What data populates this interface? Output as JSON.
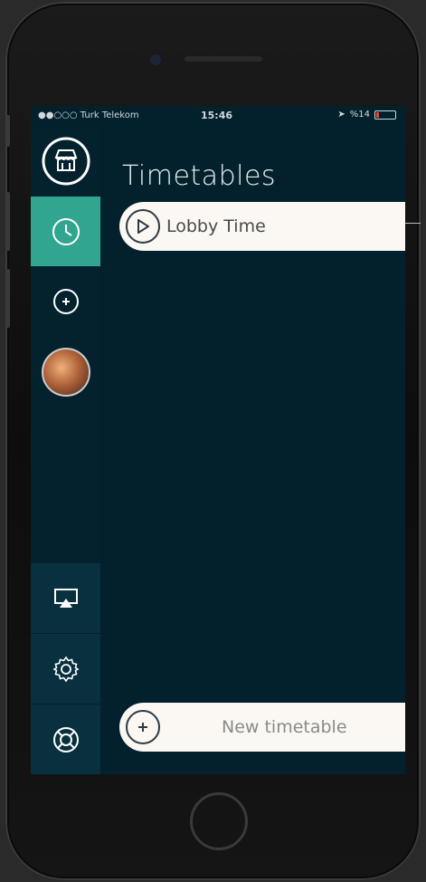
{
  "status_bar": {
    "carrier": "●●○○○ Turk Telekom",
    "time": "15:46",
    "battery": "%14",
    "battery_level": 0.14
  },
  "sidebar": {
    "items": [
      {
        "name": "store-icon"
      },
      {
        "name": "clock-icon",
        "active": true
      },
      {
        "name": "add-circle-icon"
      },
      {
        "name": "avatar"
      }
    ],
    "bottom_items": [
      {
        "name": "airplay-icon"
      },
      {
        "name": "gear-icon"
      },
      {
        "name": "lifebuoy-icon"
      }
    ]
  },
  "main": {
    "title": "Timetables",
    "timetables": [
      {
        "label": "Lobby Time",
        "icon": "play-icon"
      }
    ],
    "new_button": {
      "label": "New timetable",
      "icon": "plus-icon"
    }
  },
  "colors": {
    "background": "#03202d",
    "accent": "#31a58f",
    "pill": "#fbf8f4"
  }
}
